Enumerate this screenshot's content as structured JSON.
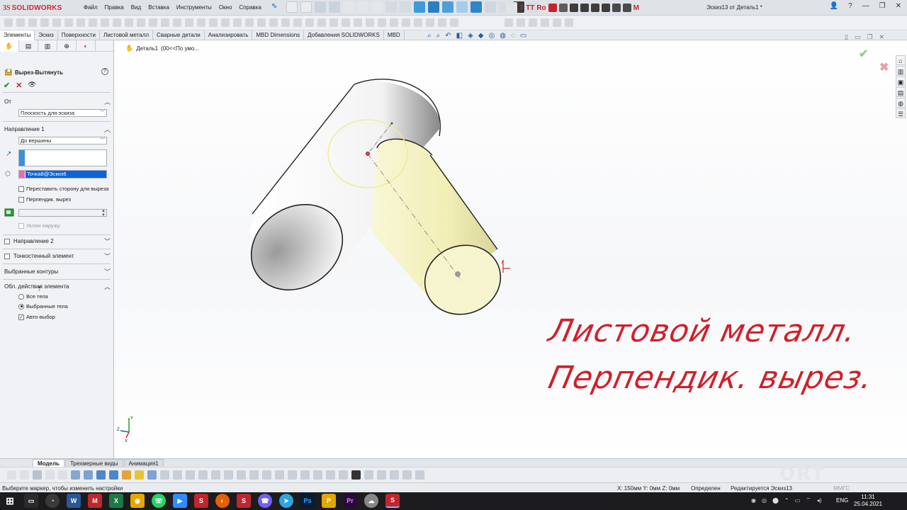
{
  "app": {
    "logo_glyph": "3S",
    "brand": "SOLIDWORKS",
    "document_title": "Эскиз13 от Деталь1 *"
  },
  "menus": [
    "Файл",
    "Правка",
    "Вид",
    "Вставка",
    "Инструменты",
    "Окно",
    "Справка"
  ],
  "cm_tabs": [
    "Элементы",
    "Эскиз",
    "Поверхности",
    "Листовой металл",
    "Сварные детали",
    "Анализировать",
    "MBD Dimensions",
    "Добавления SOLIDWORKS",
    "MBD"
  ],
  "property_manager": {
    "feature_title": "Вырез-Вытянуть",
    "help_glyph": "?",
    "ok_glyph": "✔",
    "cancel_glyph": "✕",
    "preview_glyph": "👁",
    "from": {
      "label": "От",
      "value": "Плоскость для эскиза"
    },
    "direction1": {
      "label": "Направление 1",
      "end_condition": "До вершины",
      "vertex_value": "Точка8@Эскиз6",
      "flip_side_label": "Переставить сторону для выреза",
      "flip_side_checked": false,
      "normal_cut_label": "Перпендик. вырез",
      "normal_cut_checked": false,
      "draft_outward_label": "Уклон наружу"
    },
    "direction2_label": "Направление 2",
    "thin_feature_label": "Тонкостенный элемент",
    "selected_contours_label": "Выбранные контуры",
    "feature_scope": {
      "label": "Обл. действия элемента",
      "all_bodies": "Все тела",
      "selected_bodies": "Выбранные тела",
      "auto_select": "Авто-выбор",
      "selected": "selected_bodies",
      "auto_select_checked": true
    }
  },
  "breadcrumb": {
    "part": "Деталь1",
    "config": "(00<<По умо..."
  },
  "overlay": {
    "line1": "Листовой металл.",
    "line2": "Перпендик. вырез.",
    "color": "#d11f2a"
  },
  "bottom_tabs": [
    "Модель",
    "Трехмерные виды",
    "Анимация1"
  ],
  "bottom_tab_active": "Модель",
  "watermark": "ORT DNIPRO",
  "status": {
    "message": "Выберите маркер, чтобы изменить настройки",
    "coords": "X: 150мм Y: 0мм Z: 0мм",
    "state": "Определен",
    "editing": "Редактируется Эскиз13",
    "units": "ММГС"
  },
  "taskbar": {
    "lang": "ENG",
    "time": "11:31",
    "date": "25.04.2021"
  },
  "colors": {
    "accent": "#d7262d",
    "selection_blue": "#0a64d8",
    "cut_body_yellow": "#f4f1c0"
  }
}
